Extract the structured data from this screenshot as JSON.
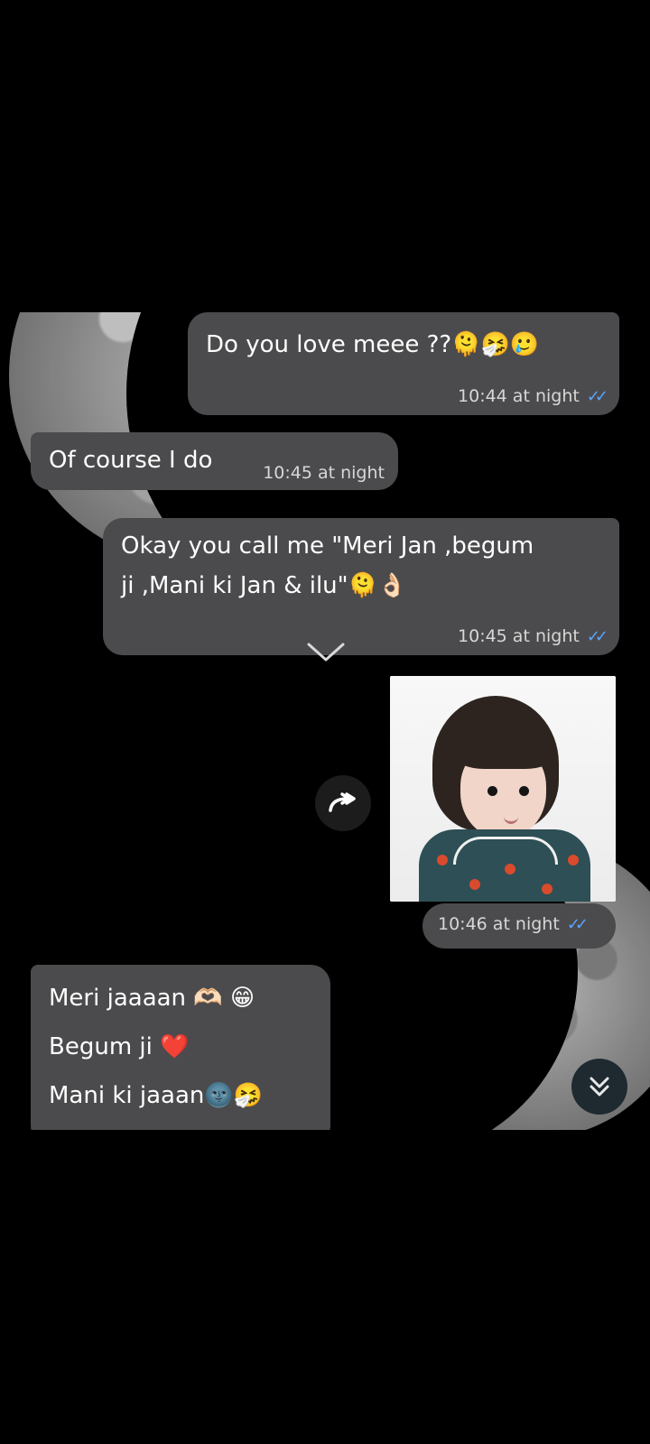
{
  "messages": [
    {
      "id": "m1",
      "direction": "outgoing",
      "text": "Do you love meee ??🫠🤧🥲",
      "time": "10:44 at night",
      "ticks": "✓✓"
    },
    {
      "id": "m2",
      "direction": "incoming",
      "text": "Of course I do",
      "time": "10:45 at night"
    },
    {
      "id": "m3",
      "direction": "outgoing",
      "text": "Okay you call me \"Meri Jan ,begum\nji ,Mani ki Jan & ilu\"🫠👌🏻",
      "time": "10:45 at night",
      "ticks": "✓✓"
    },
    {
      "id": "m4",
      "direction": "outgoing",
      "type": "image",
      "time": "10:46 at night",
      "ticks": "✓✓"
    },
    {
      "id": "m5",
      "direction": "incoming",
      "text": "Meri jaaaan 🫶🏻 😁\nBegum ji ❤️\nMani ki jaaan🌚🤧"
    }
  ],
  "icons": {
    "forward": "forward-icon",
    "scroll": "double-chevron-down-icon",
    "divider": "chevron-down-icon"
  },
  "colors": {
    "bubble": "#4b4b4d",
    "tick_blue": "#5da4ff",
    "background": "#000000"
  }
}
